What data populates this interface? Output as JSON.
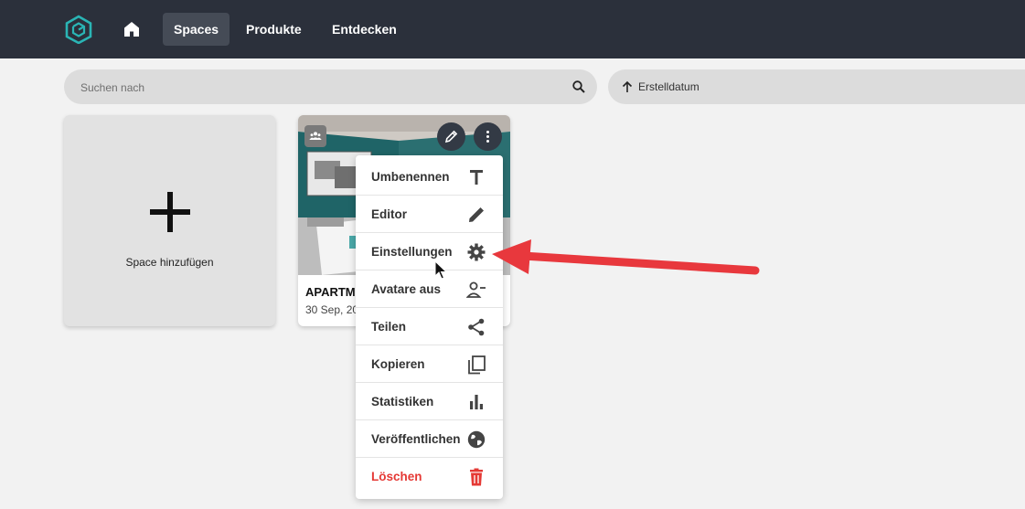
{
  "nav": {
    "logo_icon": "cube-logo-icon",
    "home_icon": "home-icon",
    "items": [
      {
        "label": "Spaces",
        "active": true
      },
      {
        "label": "Produkte",
        "active": false
      },
      {
        "label": "Entdecken",
        "active": false
      }
    ]
  },
  "search": {
    "placeholder": "Suchen nach",
    "value": "",
    "icon": "search-icon"
  },
  "sort": {
    "label": "Erstelldatum",
    "icon": "arrow-up-icon"
  },
  "add_card": {
    "label": "Space hinzufügen",
    "icon": "plus-icon"
  },
  "space_card": {
    "title": "APARTM",
    "date": "30 Sep, 20",
    "badge_icon": "group-icon",
    "edit_icon": "pencil-icon",
    "more_icon": "more-vertical-icon"
  },
  "context_menu": {
    "items": [
      {
        "label": "Umbenennen",
        "icon": "text-icon"
      },
      {
        "label": "Editor",
        "icon": "pencil-icon"
      },
      {
        "label": "Einstellungen",
        "icon": "gear-icon"
      },
      {
        "label": "Avatare aus",
        "icon": "person-remove-icon"
      },
      {
        "label": "Teilen",
        "icon": "share-icon"
      },
      {
        "label": "Kopieren",
        "icon": "copy-icon"
      },
      {
        "label": "Statistiken",
        "icon": "bar-chart-icon"
      },
      {
        "label": "Veröffentlichen",
        "icon": "globe-icon"
      },
      {
        "label": "Löschen",
        "icon": "trash-icon",
        "danger": true
      }
    ]
  },
  "colors": {
    "topbar": "#2b303b",
    "accent": "#2ab5b5",
    "danger": "#e53935",
    "annotation_arrow": "#e8383d"
  }
}
